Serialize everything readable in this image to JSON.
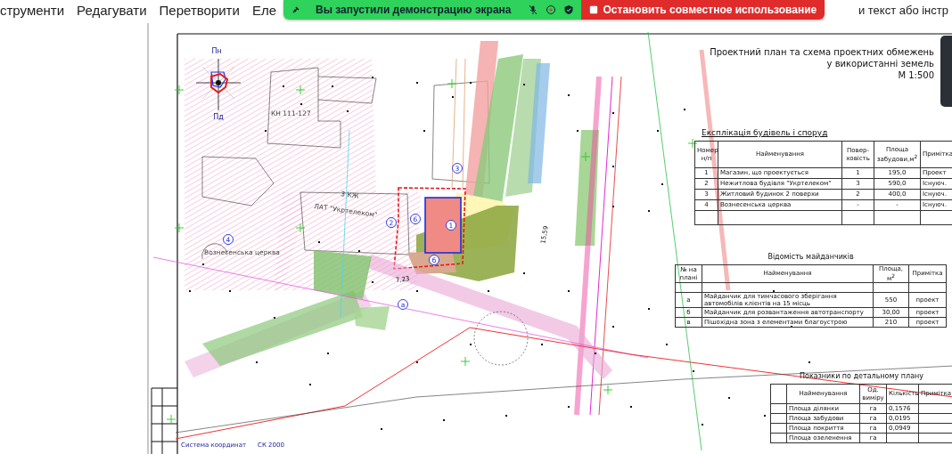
{
  "menu": [
    "струменти",
    "Редагувати",
    "Перетворити",
    "Еле",
    "и текст або інстр"
  ],
  "share_banner": {
    "message": "Вы запустили демонстрацию экрана",
    "stop_button": "Остановить совместное использование"
  },
  "title": [
    "Проектний план та схема проектних обмежень",
    "у використанні земель",
    "М 1:500"
  ],
  "plan_labels": [
    {
      "text": "Пн",
      "kind": "compass"
    },
    {
      "text": "Пд",
      "kind": "compass"
    },
    {
      "text": "1",
      "kind": "marker"
    },
    {
      "text": "2",
      "kind": "marker"
    },
    {
      "text": "3",
      "kind": "marker"
    },
    {
      "text": "4",
      "kind": "marker"
    },
    {
      "text": "6",
      "kind": "marker"
    },
    {
      "text": "б",
      "kind": "marker"
    },
    {
      "text": "а",
      "kind": "marker"
    },
    {
      "text": "КН 111-127",
      "kind": "caption"
    },
    {
      "text": "3 КЖ",
      "kind": "caption"
    },
    {
      "text": "ЛАТ \"Укртелеком\"",
      "kind": "caption"
    },
    {
      "text": "Вознесенська церква",
      "kind": "caption"
    },
    {
      "text": "7,23",
      "kind": "dimension"
    },
    {
      "text": "15,59",
      "kind": "dimension"
    }
  ],
  "buildings_table": {
    "title": "Експлікація будівель і споруд",
    "columns": [
      "Номер н/п",
      "Найменування",
      "Повер-ховість",
      "Площа забудови,м$^{2}$",
      "Примітка"
    ],
    "rows": [
      [
        "1",
        "Магазин, що проектується",
        "1",
        "195,0",
        "Проект"
      ],
      [
        "2",
        "Нежитлова будівля \"Укртелеком\"",
        "3",
        "590,0",
        "Існуюч."
      ],
      [
        "3",
        "Житловий будинок 2 поверхи",
        "2",
        "400,0",
        "Існуюч."
      ],
      [
        "4",
        "Вознесенська церква",
        "-",
        "-",
        "Існуюч."
      ]
    ]
  },
  "sites_table": {
    "title": "Відомість майданчиків",
    "columns": [
      "№ на плані",
      "Найменування",
      "Площа, м$^{2}$",
      "Примітка"
    ],
    "rows": [
      [
        "а",
        "Майданчик для тимчасового зберігання автомобілів клієнтів на 15 місць",
        "550",
        "проект"
      ],
      [
        "б",
        "Майданчик для розвантаження автотранспорту",
        "30,00",
        "проект"
      ],
      [
        "в",
        "Пішохідна зона з елементами благоустрою",
        "210",
        "проект"
      ]
    ]
  },
  "indicators_table": {
    "title": "Показники по детальному плану",
    "columns": [
      "Найменування",
      "Од. виміру",
      "Кількість",
      "Примітка"
    ],
    "rows": [
      [
        "Площа ділянки",
        "га",
        "0,1576"
      ],
      [
        "Площа забудови",
        "га",
        "0,0195"
      ],
      [
        "Площа покриття",
        "га",
        "0,0949"
      ],
      [
        "Площа озеленення",
        "га"
      ]
    ]
  },
  "coordinate_system": {
    "label": "Система координат",
    "value": "СК 2000"
  }
}
